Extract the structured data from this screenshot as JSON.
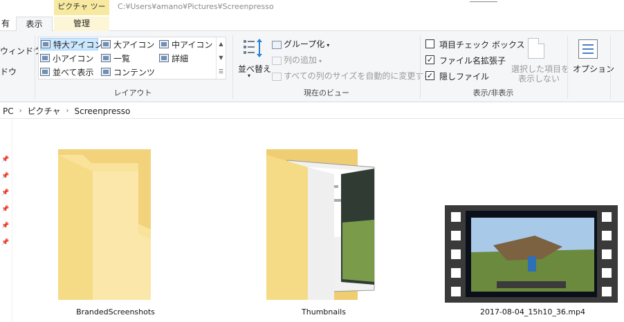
{
  "window": {
    "context_tab_header": "ピクチャ ツール",
    "title_path": "C:¥Users¥amano¥Pictures¥Screenpresso"
  },
  "tabs": [
    {
      "label": "有"
    },
    {
      "label": "表示"
    },
    {
      "label": "管理"
    }
  ],
  "ribbon": {
    "pane": {
      "items": [
        "ウィンドウ",
        "ドウ"
      ]
    },
    "layout": {
      "items": [
        "特大アイコン",
        "大アイコン",
        "中アイコン",
        "小アイコン",
        "一覧",
        "詳細",
        "並べて表示",
        "コンテンツ"
      ],
      "group_label": "レイアウト"
    },
    "current_view": {
      "sort_label": "並べ替え",
      "group_by": "グループ化",
      "add_column": "列の追加",
      "autosize": "すべての列のサイズを自動的に変更する",
      "group_label": "現在のビュー"
    },
    "show_hide": {
      "item_checkboxes": {
        "label": "項目チェック ボックス",
        "checked": false
      },
      "file_extensions": {
        "label": "ファイル名拡張子",
        "checked": true
      },
      "hidden_items": {
        "label": "隠しファイル",
        "checked": true
      },
      "hide_selected_line1": "選択した項目を",
      "hide_selected_line2": "表示しない",
      "group_label": "表示/非表示"
    },
    "options_label": "オプション"
  },
  "address": {
    "crumbs": [
      "PC",
      "ピクチャ",
      "Screenpresso"
    ]
  },
  "files": [
    {
      "name": "BrandedScreenshots",
      "type": "folder"
    },
    {
      "name": "Thumbnails",
      "type": "folder-with-preview"
    },
    {
      "name": "2017-08-04_15h10_36.mp4",
      "type": "video"
    }
  ],
  "colors": {
    "ribbon_bg": "#f5f6f7",
    "folder_yellow": "#f4d77e",
    "selection_blue": "#cce8ff",
    "context_yellow": "#f8e9a1"
  }
}
